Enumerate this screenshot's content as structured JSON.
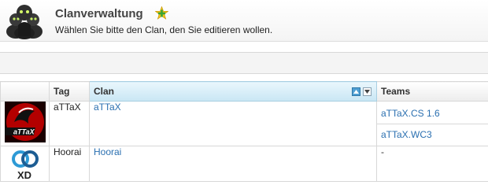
{
  "header": {
    "icon": "clan-group-icon",
    "title": "Clanverwaltung",
    "add_icon": "add-plus-icon",
    "subtitle": "Wählen Sie bitte den Clan, den Sie editieren wollen."
  },
  "table": {
    "columns": {
      "logo": "",
      "tag": "Tag",
      "clan": "Clan",
      "teams": "Teams"
    },
    "sort": {
      "column": "Clan",
      "asc_icon": "sort-ascending-icon",
      "desc_icon": "sort-descending-icon"
    },
    "rows": [
      {
        "logo": "attax-logo",
        "tag": "aTTaX",
        "clan": "aTTaX",
        "teams": [
          "aTTaX.CS 1.6",
          "aTTaX.WC3"
        ],
        "logo_text": "aTTaX"
      },
      {
        "logo": "xd-logo",
        "tag": "Hoorai",
        "clan": "Hoorai",
        "teams": [],
        "teams_empty": "-",
        "logo_text": "XD"
      }
    ]
  },
  "colors": {
    "link": "#2a6fb0",
    "sorted_header": "#c9e6f4",
    "border": "#d8d8d8"
  }
}
